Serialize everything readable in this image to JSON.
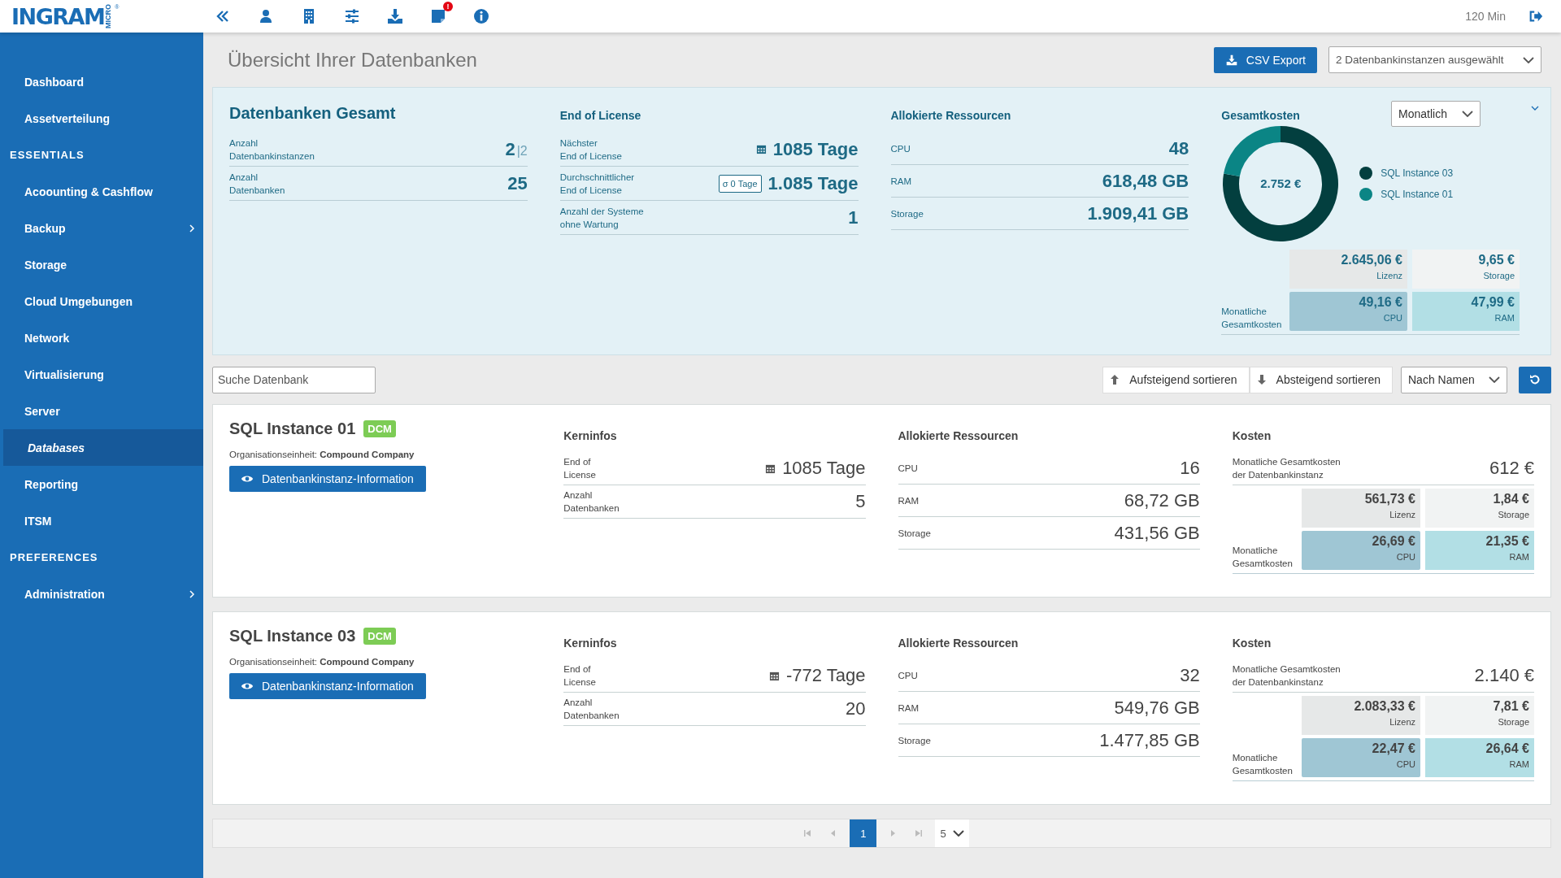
{
  "logo": {
    "name": "INGRAM",
    "sub": "MICRO",
    "mark": "®"
  },
  "toolbar": {
    "notification_badge": "!",
    "session": "120 Min"
  },
  "sidebar": {
    "items": [
      {
        "kind": "item",
        "label": "Dashboard",
        "selected": false,
        "has_submenu": false
      },
      {
        "kind": "item",
        "label": "Assetverteilung",
        "selected": false,
        "has_submenu": false
      },
      {
        "kind": "section",
        "label": "ESSENTIALS"
      },
      {
        "kind": "item",
        "label": "Acoounting & Cashflow",
        "selected": false,
        "has_submenu": false
      },
      {
        "kind": "item",
        "label": "Backup",
        "selected": false,
        "has_submenu": true
      },
      {
        "kind": "item",
        "label": "Storage",
        "selected": false,
        "has_submenu": false
      },
      {
        "kind": "item",
        "label": "Cloud Umgebungen",
        "selected": false,
        "has_submenu": false
      },
      {
        "kind": "item",
        "label": "Network",
        "selected": false,
        "has_submenu": false
      },
      {
        "kind": "item",
        "label": "Virtualisierung",
        "selected": false,
        "has_submenu": false
      },
      {
        "kind": "item",
        "label": "Server",
        "selected": false,
        "has_submenu": false
      },
      {
        "kind": "item",
        "label": "Databases",
        "selected": true,
        "has_submenu": false
      },
      {
        "kind": "item",
        "label": "Reporting",
        "selected": false,
        "has_submenu": false
      },
      {
        "kind": "item",
        "label": "ITSM",
        "selected": false,
        "has_submenu": false
      },
      {
        "kind": "section",
        "label": "PREFERENCES"
      },
      {
        "kind": "item",
        "label": "Administration",
        "selected": false,
        "has_submenu": true
      }
    ]
  },
  "page": {
    "title": "Übersicht Ihrer Datenbanken",
    "export_button": "CSV Export",
    "instance_select": "2 Datenbankinstanzen ausgewählt"
  },
  "summary": {
    "totals": {
      "title": "Datenbanken Gesamt",
      "rows": [
        {
          "label": "Anzahl\nDatenbankinstanzen",
          "value": "2",
          "suffix": "|2"
        },
        {
          "label": "Anzahl\nDatenbanken",
          "value": "25"
        }
      ]
    },
    "license": {
      "title": "End of License",
      "rows": [
        {
          "kind": "calendar",
          "label": "Nächster\nEnd of License",
          "value": "1085 Tage"
        },
        {
          "kind": "badge",
          "label": "Durchschnittlicher\nEnd of License",
          "badge": "σ 0 Tage",
          "value": "1.085 Tage"
        },
        {
          "kind": "plain",
          "label": "Anzahl der Systeme\nohne Wartung",
          "value": "1"
        }
      ]
    },
    "resources": {
      "title": "Allokierte Ressourcen",
      "rows": [
        {
          "label": "CPU",
          "value": "48"
        },
        {
          "label": "RAM",
          "value": "618,48 GB"
        },
        {
          "label": "Storage",
          "value": "1.909,41 GB"
        }
      ]
    },
    "costs": {
      "title": "Gesamtkosten",
      "period": "Monatlich",
      "total": "2.752 €",
      "chart_data": {
        "type": "donut",
        "categories": [
          "SQL Instance 03",
          "SQL Instance 01"
        ],
        "values": [
          77.8,
          22.2
        ]
      },
      "legend": [
        {
          "color": "#033f3f"
        },
        {
          "color": "#0b8585"
        }
      ],
      "tiles": [
        {
          "kind": "license",
          "value": "2.645,06 €",
          "label": "Lizenz"
        },
        {
          "kind": "storage",
          "value": "9,65 €",
          "label": "Storage"
        },
        {
          "kind": "cpu",
          "value": "49,16 €",
          "label": "CPU"
        },
        {
          "kind": "ram",
          "value": "47,99 €",
          "label": "RAM"
        }
      ],
      "footer_label": "Monatliche\nGesamtkosten"
    }
  },
  "toolbar_row": {
    "search_placeholder": "Suche Datenbank",
    "sort_ascending": "Aufsteigend sortieren",
    "sort_descending": "Absteigend sortieren",
    "sort_by": "Nach Namen"
  },
  "instances": [
    {
      "name": "SQL Instance 01",
      "tag": "DCM",
      "org": "Organisationseinheit: **Compound Company**",
      "info_button": "Datenbankinstanz-Information",
      "core_title": "Kerninfos",
      "core": [
        {
          "kind": "calendar",
          "label": "End of\nLicense",
          "value": "1085 Tage"
        },
        {
          "kind": "plain",
          "label": "Anzahl\nDatenbanken",
          "value": "5"
        }
      ],
      "resources_title": "Allokierte Ressourcen",
      "resources": [
        {
          "label": "CPU",
          "value": "16"
        },
        {
          "label": "RAM",
          "value": "68,72 GB"
        },
        {
          "label": "Storage",
          "value": "431,56 GB"
        }
      ],
      "costs_title": "Kosten",
      "total_label": "Monatliche Gesamtkosten\nder Datenbankinstanz",
      "total": "612 €",
      "tiles": [
        {
          "kind": "license",
          "value": "561,73 €",
          "label": "Lizenz"
        },
        {
          "kind": "storage",
          "value": "1,84 €",
          "label": "Storage"
        },
        {
          "kind": "cpu",
          "value": "26,69 €",
          "label": "CPU"
        },
        {
          "kind": "ram",
          "value": "21,35 €",
          "label": "RAM"
        }
      ],
      "footer_label": "Monatliche\nGesamtkosten"
    },
    {
      "name": "SQL Instance 03",
      "tag": "DCM",
      "org": "Organisationseinheit: **Compound Company**",
      "info_button": "Datenbankinstanz-Information",
      "core_title": "Kerninfos",
      "core": [
        {
          "kind": "calendar",
          "label": "End of\nLicense",
          "value": "-772 Tage"
        },
        {
          "kind": "plain",
          "label": "Anzahl\nDatenbanken",
          "value": "20"
        }
      ],
      "resources_title": "Allokierte Ressourcen",
      "resources": [
        {
          "label": "CPU",
          "value": "32"
        },
        {
          "label": "RAM",
          "value": "549,76 GB"
        },
        {
          "label": "Storage",
          "value": "1.477,85 GB"
        }
      ],
      "costs_title": "Kosten",
      "total_label": "Monatliche Gesamtkosten\nder Datenbankinstanz",
      "total": "2.140 €",
      "tiles": [
        {
          "kind": "license",
          "value": "2.083,33 €",
          "label": "Lizenz"
        },
        {
          "kind": "storage",
          "value": "7,81 €",
          "label": "Storage"
        },
        {
          "kind": "cpu",
          "value": "22,47 €",
          "label": "CPU"
        },
        {
          "kind": "ram",
          "value": "26,64 €",
          "label": "RAM"
        }
      ],
      "footer_label": "Monatliche\nGesamtkosten"
    }
  ],
  "pagination": {
    "pages": [
      {
        "label": "1",
        "selected": true
      }
    ],
    "page_size": "5"
  }
}
